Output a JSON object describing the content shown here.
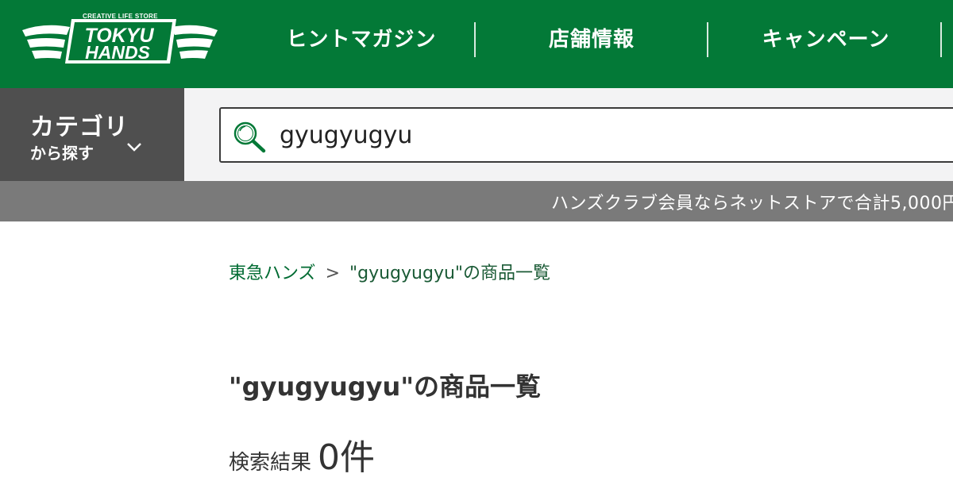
{
  "brand": {
    "tagline": "CREATIVE LIFE STORE",
    "line1": "TOKYU",
    "line2": "HANDS",
    "color": "#037937"
  },
  "nav": {
    "items": [
      {
        "label": "ヒントマガジン"
      },
      {
        "label": "店舗情報"
      },
      {
        "label": "キャンペーン"
      }
    ]
  },
  "category": {
    "title": "カテゴリ",
    "subtitle": "から探す",
    "icon": "chevron-down-icon"
  },
  "search": {
    "value": "gyugyugyu",
    "icon": "search-icon"
  },
  "notice": {
    "text": "ハンズクラブ会員ならネットストアで合計5,000円("
  },
  "breadcrumb": {
    "home": "東急ハンズ",
    "separator": ">",
    "current": "\"gyugyugyu\"の商品一覧"
  },
  "main": {
    "title": "\"gyugyugyu\"の商品一覧",
    "result_label": "検索結果",
    "result_count": "0件"
  }
}
